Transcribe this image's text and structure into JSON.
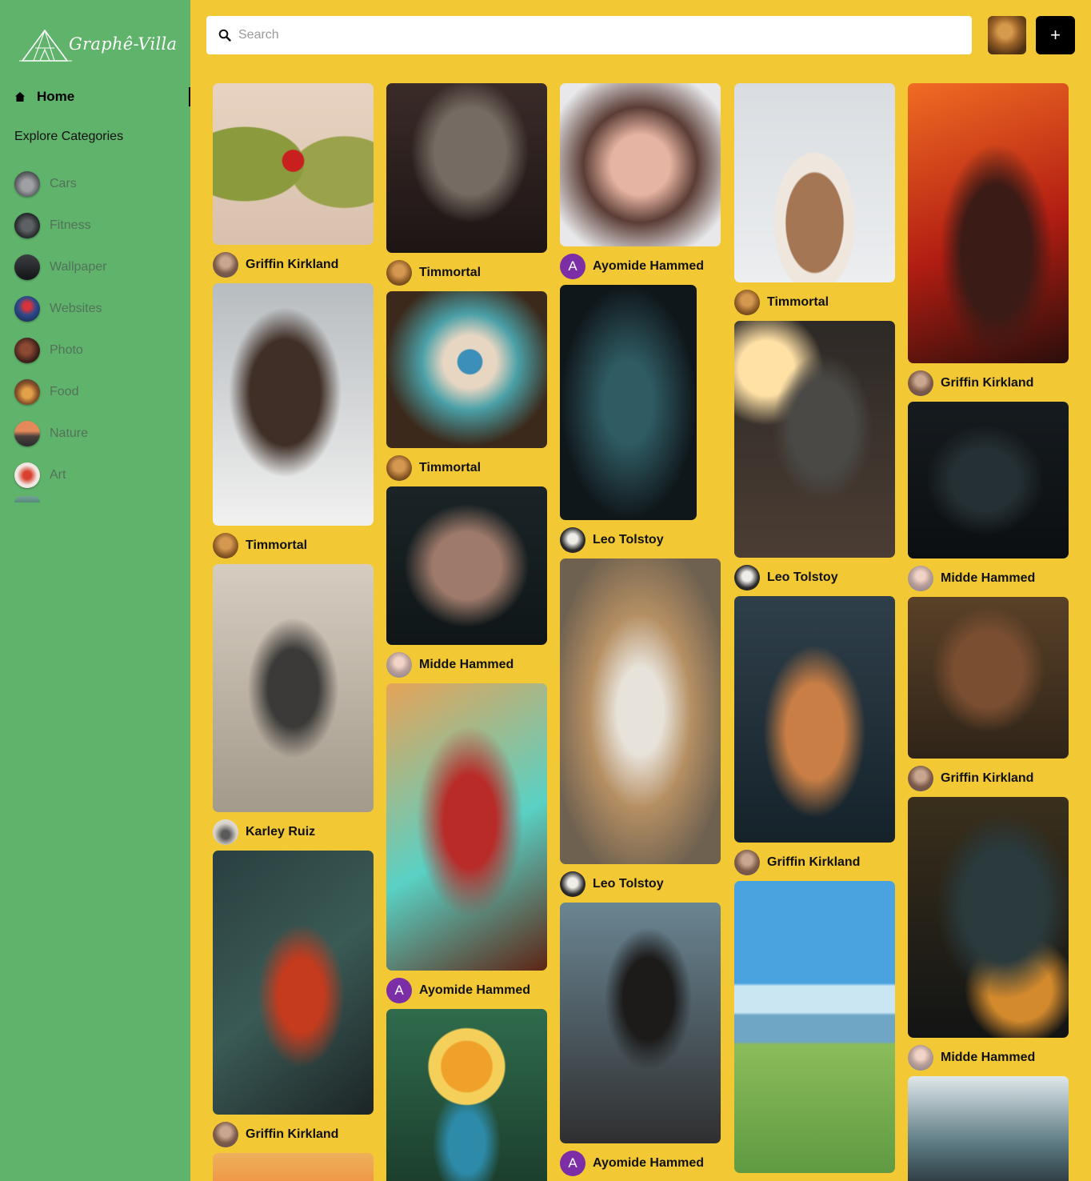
{
  "brand": {
    "name": "Graphê-Villa"
  },
  "sidebar": {
    "home_label": "Home",
    "explore_label": "Explore Categories",
    "categories": [
      {
        "label": "Cars",
        "color": "#6c6e70"
      },
      {
        "label": "Fitness",
        "color": "#3a3d40"
      },
      {
        "label": "Wallpaper",
        "color": "#2f3134"
      },
      {
        "label": "Websites",
        "color": "#2d4a8c"
      },
      {
        "label": "Photo",
        "color": "#4a2620"
      },
      {
        "label": "Food",
        "color": "#a86b2e"
      },
      {
        "label": "Nature",
        "color": "#8a5b4a"
      },
      {
        "label": "Art",
        "color": "#c43a2a"
      }
    ]
  },
  "search": {
    "placeholder": "Search",
    "value": ""
  },
  "topbar": {
    "add_label": "+"
  },
  "feed": {
    "pins": [
      {
        "author": "Griffin Kirkland",
        "avatar": "griffin"
      },
      {
        "author": "Timmortal",
        "avatar": "timmortal"
      },
      {
        "author": "Karley Ruiz",
        "avatar": "karley"
      },
      {
        "author": "Griffin Kirkland",
        "avatar": "griffin"
      },
      {
        "author": "",
        "avatar": ""
      },
      {
        "author": "Timmortal",
        "avatar": "timmortal"
      },
      {
        "author": "Timmortal",
        "avatar": "timmortal"
      },
      {
        "author": "Midde Hammed",
        "avatar": "midde"
      },
      {
        "author": "Ayomide Hammed",
        "avatar": "A"
      },
      {
        "author": "",
        "avatar": ""
      },
      {
        "author": "Ayomide Hammed",
        "avatar": "A"
      },
      {
        "author": "Leo Tolstoy",
        "avatar": "leo"
      },
      {
        "author": "Leo Tolstoy",
        "avatar": "leo"
      },
      {
        "author": "Ayomide Hammed",
        "avatar": "A"
      },
      {
        "author": "Timmortal",
        "avatar": "timmortal"
      },
      {
        "author": "Leo Tolstoy",
        "avatar": "leo"
      },
      {
        "author": "Griffin Kirkland",
        "avatar": "griffin"
      },
      {
        "author": "",
        "avatar": ""
      },
      {
        "author": "Griffin Kirkland",
        "avatar": "griffin"
      },
      {
        "author": "Midde Hammed",
        "avatar": "midde"
      },
      {
        "author": "Griffin Kirkland",
        "avatar": "griffin"
      },
      {
        "author": "Midde Hammed",
        "avatar": "midde"
      },
      {
        "author": "",
        "avatar": ""
      }
    ]
  }
}
